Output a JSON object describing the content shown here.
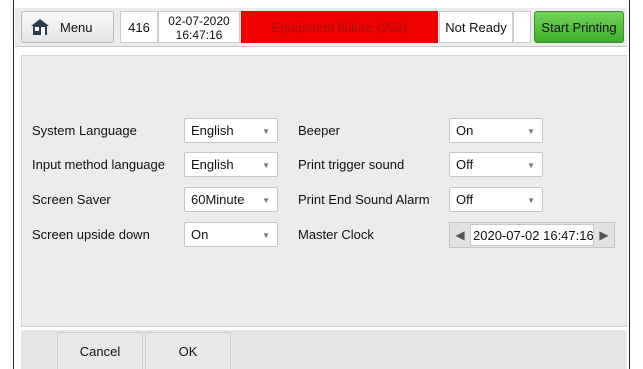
{
  "topbar": {
    "menu_label": "Menu",
    "menu_icon": "home-icon",
    "counter": "416",
    "date": "02-07-2020",
    "time": "16:47:16",
    "status_error": "Equipment failure (202)",
    "status_ready": "Not Ready",
    "start_label": "Start Printing"
  },
  "settings": {
    "left": [
      {
        "label": "System Language",
        "value": "English"
      },
      {
        "label": "Input method language",
        "value": "English"
      },
      {
        "label": "Screen Saver",
        "value": "60Minute"
      },
      {
        "label": "Screen upside down",
        "value": "On"
      }
    ],
    "right": [
      {
        "label": "Beeper",
        "value": "On"
      },
      {
        "label": "Print trigger sound",
        "value": "Off"
      },
      {
        "label": "Print End Sound Alarm",
        "value": "Off"
      }
    ],
    "master_clock": {
      "label": "Master Clock",
      "value": "2020-07-02 16:47:16"
    }
  },
  "footer": {
    "cancel_label": "Cancel",
    "ok_label": "OK"
  },
  "colors": {
    "error_bg": "#f00000",
    "start_bg": "#4fbf38",
    "panel_bg": "#ececec"
  }
}
